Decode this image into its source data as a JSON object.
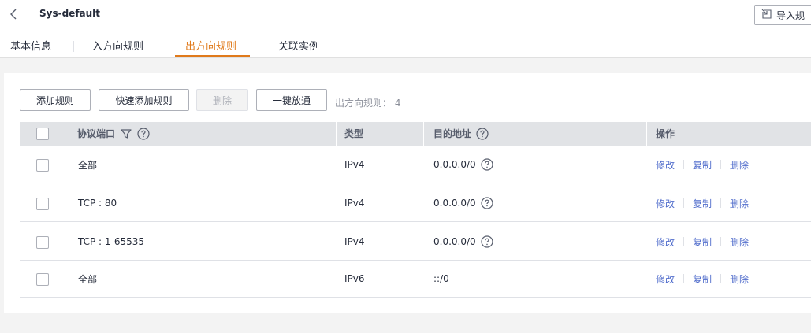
{
  "header": {
    "title": "Sys-default",
    "import_button": "导入规"
  },
  "tabs": [
    {
      "label": "基本信息"
    },
    {
      "label": "入方向规则"
    },
    {
      "label": "出方向规则"
    },
    {
      "label": "关联实例"
    }
  ],
  "toolbar": {
    "add_rule": "添加规则",
    "quick_add_rule": "快速添加规则",
    "delete": "删除",
    "one_click_allow": "一键放通",
    "rule_count_label": "出方向规则：",
    "rule_count_value": "4"
  },
  "table": {
    "columns": {
      "protocol_port": "协议端口",
      "type": "类型",
      "destination": "目的地址",
      "operation": "操作"
    },
    "rows": [
      {
        "protocol_port": "全部",
        "type": "IPv4",
        "destination": "0.0.0.0/0",
        "ops": [
          "修改",
          "复制",
          "删除"
        ]
      },
      {
        "protocol_port": "TCP : 80",
        "type": "IPv4",
        "destination": "0.0.0.0/0",
        "ops": [
          "修改",
          "复制",
          "删除"
        ]
      },
      {
        "protocol_port": "TCP : 1-65535",
        "type": "IPv4",
        "destination": "0.0.0.0/0",
        "ops": [
          "修改",
          "复制",
          "删除"
        ]
      },
      {
        "protocol_port": "全部",
        "type": "IPv6",
        "destination": "::/0",
        "ops": [
          "修改",
          "复制",
          "删除"
        ]
      }
    ]
  },
  "colors": {
    "accent": "#e07a1b",
    "link": "#526ecc",
    "header_bg": "#e1e3e6"
  },
  "icons": {
    "back": "chevron-left-icon",
    "import": "import-icon",
    "filter": "filter-icon",
    "help": "help-circle-icon"
  }
}
